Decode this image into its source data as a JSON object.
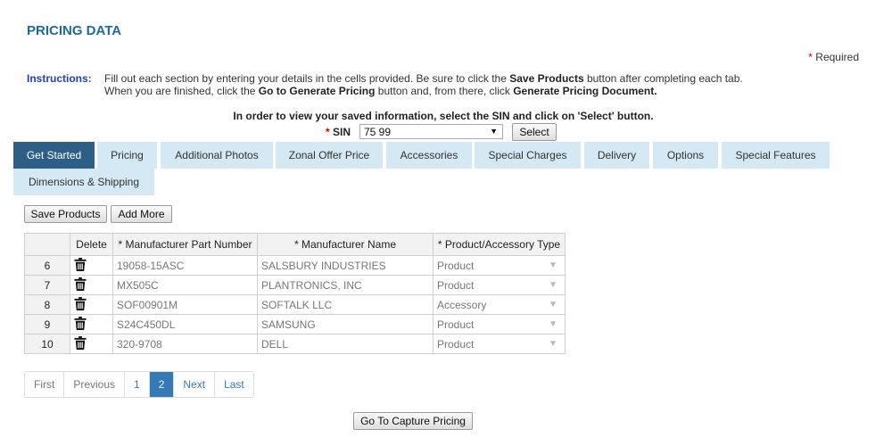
{
  "title": "PRICING DATA",
  "required_note": "Required",
  "instructions": {
    "label": "Instructions:",
    "line1_a": "Fill out each section by entering your details in the cells provided. Be sure to click the ",
    "line1_b": "Save Products",
    "line1_c": " button after completing each tab.",
    "line2_a": "When you are finished, click the ",
    "line2_b": "Go to Generate Pricing",
    "line2_c": " button and, from there, click ",
    "line2_d": "Generate Pricing Document."
  },
  "sin": {
    "note": "In order to view your saved information, select the SIN and click on 'Select' button.",
    "label": "SIN",
    "value": "75 99",
    "select_button": "Select"
  },
  "tabs": [
    {
      "label": "Get Started",
      "active": true
    },
    {
      "label": "Pricing"
    },
    {
      "label": "Additional Photos"
    },
    {
      "label": "Zonal Offer Price"
    },
    {
      "label": "Accessories"
    },
    {
      "label": "Special Charges"
    },
    {
      "label": "Delivery"
    },
    {
      "label": "Options"
    },
    {
      "label": "Special Features"
    },
    {
      "label": "Dimensions & Shipping"
    }
  ],
  "toolbar": {
    "save_label": "Save Products",
    "add_more_label": "Add More"
  },
  "table": {
    "columns": [
      "",
      "Delete",
      "* Manufacturer Part Number",
      "* Manufacturer Name",
      "* Product/Accessory Type"
    ],
    "rows": [
      {
        "num": "6",
        "part": "19058-15ASC",
        "mfr": "SALSBURY INDUSTRIES",
        "type": "Product"
      },
      {
        "num": "7",
        "part": "MX505C",
        "mfr": "PLANTRONICS, INC",
        "type": "Product"
      },
      {
        "num": "8",
        "part": "SOF00901M",
        "mfr": "SOFTALK LLC",
        "type": "Accessory"
      },
      {
        "num": "9",
        "part": "S24C450DL",
        "mfr": "SAMSUNG",
        "type": "Product"
      },
      {
        "num": "10",
        "part": "320-9708",
        "mfr": "DELL",
        "type": "Product"
      }
    ]
  },
  "pagination": {
    "first": "First",
    "previous": "Previous",
    "pages": [
      "1",
      "2"
    ],
    "current": "2",
    "next": "Next",
    "last": "Last"
  },
  "capture_button": "Go To Capture Pricing",
  "colors": {
    "title": "#1a6aa6",
    "tab_active": "#2d5f86",
    "tab_inactive": "#d4e9f3",
    "required_star": "#d00000",
    "pager_active": "#337ab7"
  },
  "icons": {
    "delete": "trash-icon",
    "dropdown": "chevron-down-icon"
  }
}
